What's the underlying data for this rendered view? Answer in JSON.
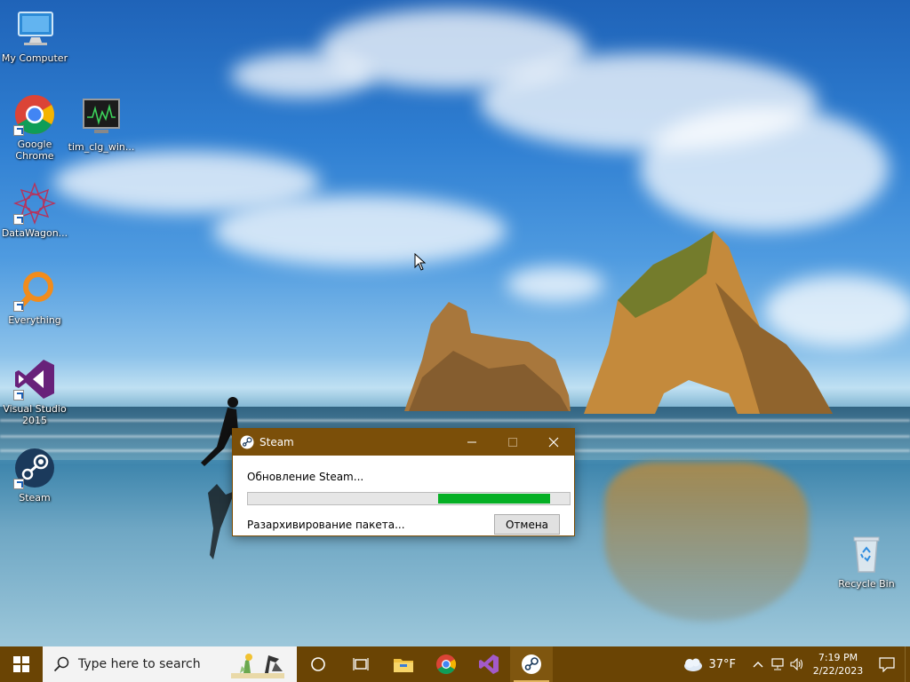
{
  "desktop": {
    "icons": [
      {
        "label": "My Computer"
      },
      {
        "label": "Google Chrome"
      },
      {
        "label": "tim_clg_win..."
      },
      {
        "label": "DataWagon..."
      },
      {
        "label": "Everything"
      },
      {
        "label": "Visual Studio 2015"
      },
      {
        "label": "Steam"
      },
      {
        "label": "Recycle Bin"
      }
    ]
  },
  "dialog": {
    "title": "Steam",
    "status_text": "Обновление Steam...",
    "progress_start": 0.59,
    "progress_end": 0.94,
    "sub_status": "Разархивирование пакета...",
    "cancel_label": "Отмена",
    "colors": {
      "titlebar": "#7b4f09",
      "progress": "#06b025"
    }
  },
  "taskbar": {
    "search_placeholder": "Type here to search",
    "pinned": [
      "file-explorer-icon",
      "chrome-icon",
      "visual-studio-icon",
      "steam-icon"
    ],
    "weather": {
      "temp": "37°F"
    },
    "clock": {
      "time": "7:19 PM",
      "date": "2/22/2023"
    },
    "color": "#6a4404"
  }
}
